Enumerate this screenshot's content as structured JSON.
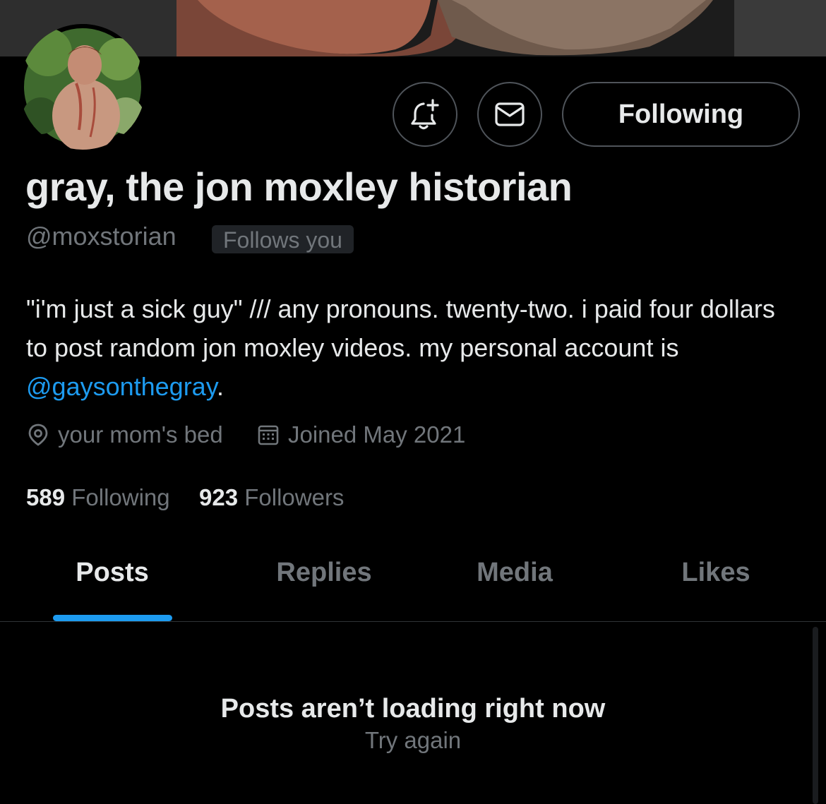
{
  "profile": {
    "display_name": "gray, the jon moxley historian",
    "handle": "@moxstorian",
    "follows_you_badge": "Follows you",
    "bio_text": "\"i'm just a sick guy\" /// any pronouns. twenty-two. i paid four dollars to post random jon moxley videos. my personal account is ",
    "bio_mention": "@gaysonthegray",
    "bio_end": ".",
    "location": "your mom's bed",
    "joined": "Joined May 2021",
    "following_count": "589",
    "following_label": "Following",
    "followers_count": "923",
    "followers_label": "Followers"
  },
  "actions": {
    "notify_icon": "bell-plus-icon",
    "message_icon": "envelope-icon",
    "following_button": "Following"
  },
  "tabs": [
    {
      "label": "Posts",
      "active": true
    },
    {
      "label": "Replies",
      "active": false
    },
    {
      "label": "Media",
      "active": false
    },
    {
      "label": "Likes",
      "active": false
    }
  ],
  "feed": {
    "error_title": "Posts aren’t loading right now",
    "retry_label": "Try again"
  },
  "colors": {
    "background": "#000000",
    "primary_text": "#e7e9ea",
    "secondary_text": "#71767b",
    "accent": "#1d9bf0",
    "border": "#4f545a"
  }
}
